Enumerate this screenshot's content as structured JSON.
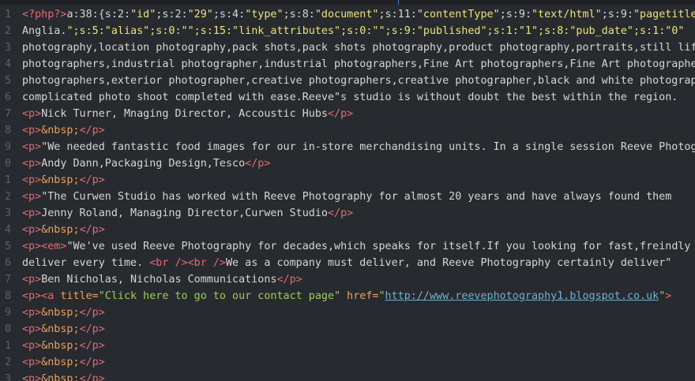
{
  "editor": {
    "line_numbers": [
      "1",
      "2",
      "3",
      "4",
      "5",
      "6",
      "7",
      "8",
      "9",
      "0",
      "1",
      "2",
      "3",
      "4",
      "5",
      "6",
      "7",
      "8",
      "9",
      "0",
      "1",
      "2",
      "3"
    ],
    "lines": [
      {
        "segments": [
          {
            "t": "php",
            "v": "<?php?>"
          },
          {
            "t": "plain",
            "v": "a:38:{s:2:"
          },
          {
            "t": "str",
            "v": "\"id\""
          },
          {
            "t": "plain",
            "v": ";s:2:"
          },
          {
            "t": "str",
            "v": "\"29\""
          },
          {
            "t": "plain",
            "v": ";s:4:"
          },
          {
            "t": "str",
            "v": "\"type\""
          },
          {
            "t": "plain",
            "v": ";s:8:"
          },
          {
            "t": "str",
            "v": "\"document\""
          },
          {
            "t": "plain",
            "v": ";s:11:"
          },
          {
            "t": "str",
            "v": "\"contentType\""
          },
          {
            "t": "plain",
            "v": ";s:9:"
          },
          {
            "t": "str",
            "v": "\"text/html\""
          },
          {
            "t": "plain",
            "v": ";s:9:"
          },
          {
            "t": "str",
            "v": "\"pagetitle\""
          }
        ]
      },
      {
        "segments": [
          {
            "t": "plain",
            "v": "Anglia."
          },
          {
            "t": "str",
            "v": "\";s:5:\"alias\";s:0:\"\";s:15:\"link_attributes\";s:0:\"\";s:9:\"published\";s:1:\"1\";s:8:\"pub_date\";s:1:\"0\""
          }
        ]
      },
      {
        "segments": [
          {
            "t": "plain",
            "v": "photography,location photography,pack shots,pack shots photography,product photography,portraits,still life"
          }
        ]
      },
      {
        "segments": [
          {
            "t": "plain",
            "v": "photographers,industrial photographer,industrial photographers,Fine Art photographers,Fine Art photographer"
          }
        ]
      },
      {
        "segments": [
          {
            "t": "plain",
            "v": "photographers,exterior photographer,creative photographers,creative photographer,black and white photography"
          }
        ]
      },
      {
        "segments": [
          {
            "t": "plain",
            "v": "complicated photo shoot completed with ease.Reeve\"s studio is without doubt the best within the region."
          }
        ]
      },
      {
        "segments": [
          {
            "t": "tag",
            "v": "<p>"
          },
          {
            "t": "plain",
            "v": "Nick Turner, Mnaging Director, Accoustic Hubs"
          },
          {
            "t": "tag",
            "v": "</p>"
          }
        ]
      },
      {
        "segments": [
          {
            "t": "tag",
            "v": "<p>"
          },
          {
            "t": "ent",
            "v": "&nbsp;"
          },
          {
            "t": "tag",
            "v": "</p>"
          }
        ]
      },
      {
        "segments": [
          {
            "t": "tag",
            "v": "<p>"
          },
          {
            "t": "plain",
            "v": "\"We needed fantastic food images for our in-store merchandising units. In a single session Reeve Photography"
          }
        ]
      },
      {
        "segments": [
          {
            "t": "tag",
            "v": "<p>"
          },
          {
            "t": "plain",
            "v": "Andy Dann,Packaging Design,Tesco"
          },
          {
            "t": "tag",
            "v": "</p>"
          }
        ]
      },
      {
        "segments": [
          {
            "t": "tag",
            "v": "<p>"
          },
          {
            "t": "ent",
            "v": "&nbsp;"
          },
          {
            "t": "tag",
            "v": "</p>"
          }
        ]
      },
      {
        "segments": [
          {
            "t": "tag",
            "v": "<p>"
          },
          {
            "t": "plain",
            "v": "\"The Curwen Studio has worked with Reeve Photography for almost 20 years and have always found them"
          }
        ]
      },
      {
        "segments": [
          {
            "t": "tag",
            "v": "<p>"
          },
          {
            "t": "plain",
            "v": "Jenny Roland, Managing Director,Curwen Studio"
          },
          {
            "t": "tag",
            "v": "</p>"
          }
        ]
      },
      {
        "segments": [
          {
            "t": "tag",
            "v": "<p>"
          },
          {
            "t": "ent",
            "v": "&nbsp;"
          },
          {
            "t": "tag",
            "v": "</p>"
          }
        ]
      },
      {
        "segments": [
          {
            "t": "tag",
            "v": "<p><em>"
          },
          {
            "t": "plain",
            "v": "\"We've used Reeve Photography for decades,which speaks for itself.If you looking for fast,freindly"
          }
        ]
      },
      {
        "segments": [
          {
            "t": "plain",
            "v": "deliver every time. "
          },
          {
            "t": "tag",
            "v": "<br />"
          },
          {
            "t": "tag",
            "v": "<br />"
          },
          {
            "t": "plain",
            "v": "We as a company must deliver, and Reeve Photography certainly deliver\""
          }
        ]
      },
      {
        "segments": [
          {
            "t": "tag",
            "v": "<p>"
          },
          {
            "t": "plain",
            "v": "Ben Nicholas, Nicholas Communications"
          },
          {
            "t": "tag",
            "v": "</p>"
          }
        ]
      },
      {
        "segments": [
          {
            "t": "tag",
            "v": "<p><a "
          },
          {
            "t": "attr",
            "v": "title="
          },
          {
            "t": "aval",
            "v": "\"Click here to go to our contact page\""
          },
          {
            "t": "plain",
            "v": " "
          },
          {
            "t": "attr",
            "v": "href="
          },
          {
            "t": "aval",
            "v": "\""
          },
          {
            "t": "url",
            "v": "http://www.reevephotography1.blogspot.co.uk"
          },
          {
            "t": "aval",
            "v": "\""
          },
          {
            "t": "tag",
            "v": ">"
          }
        ]
      },
      {
        "segments": [
          {
            "t": "tag",
            "v": "<p>"
          },
          {
            "t": "ent",
            "v": "&nbsp;"
          },
          {
            "t": "tag",
            "v": "</p>"
          }
        ]
      },
      {
        "segments": [
          {
            "t": "tag",
            "v": "<p>"
          },
          {
            "t": "ent",
            "v": "&nbsp;"
          },
          {
            "t": "tag",
            "v": "</p>"
          }
        ]
      },
      {
        "segments": [
          {
            "t": "tag",
            "v": "<p>"
          },
          {
            "t": "ent",
            "v": "&nbsp;"
          },
          {
            "t": "tag",
            "v": "</p>"
          }
        ]
      },
      {
        "segments": [
          {
            "t": "tag",
            "v": "<p>"
          },
          {
            "t": "ent",
            "v": "&nbsp;"
          },
          {
            "t": "tag",
            "v": "</p>"
          }
        ]
      },
      {
        "segments": [
          {
            "t": "tag",
            "v": "<p>"
          },
          {
            "t": "ent",
            "v": "&nbsp;"
          },
          {
            "t": "tag",
            "v": "</p>"
          }
        ]
      }
    ]
  }
}
